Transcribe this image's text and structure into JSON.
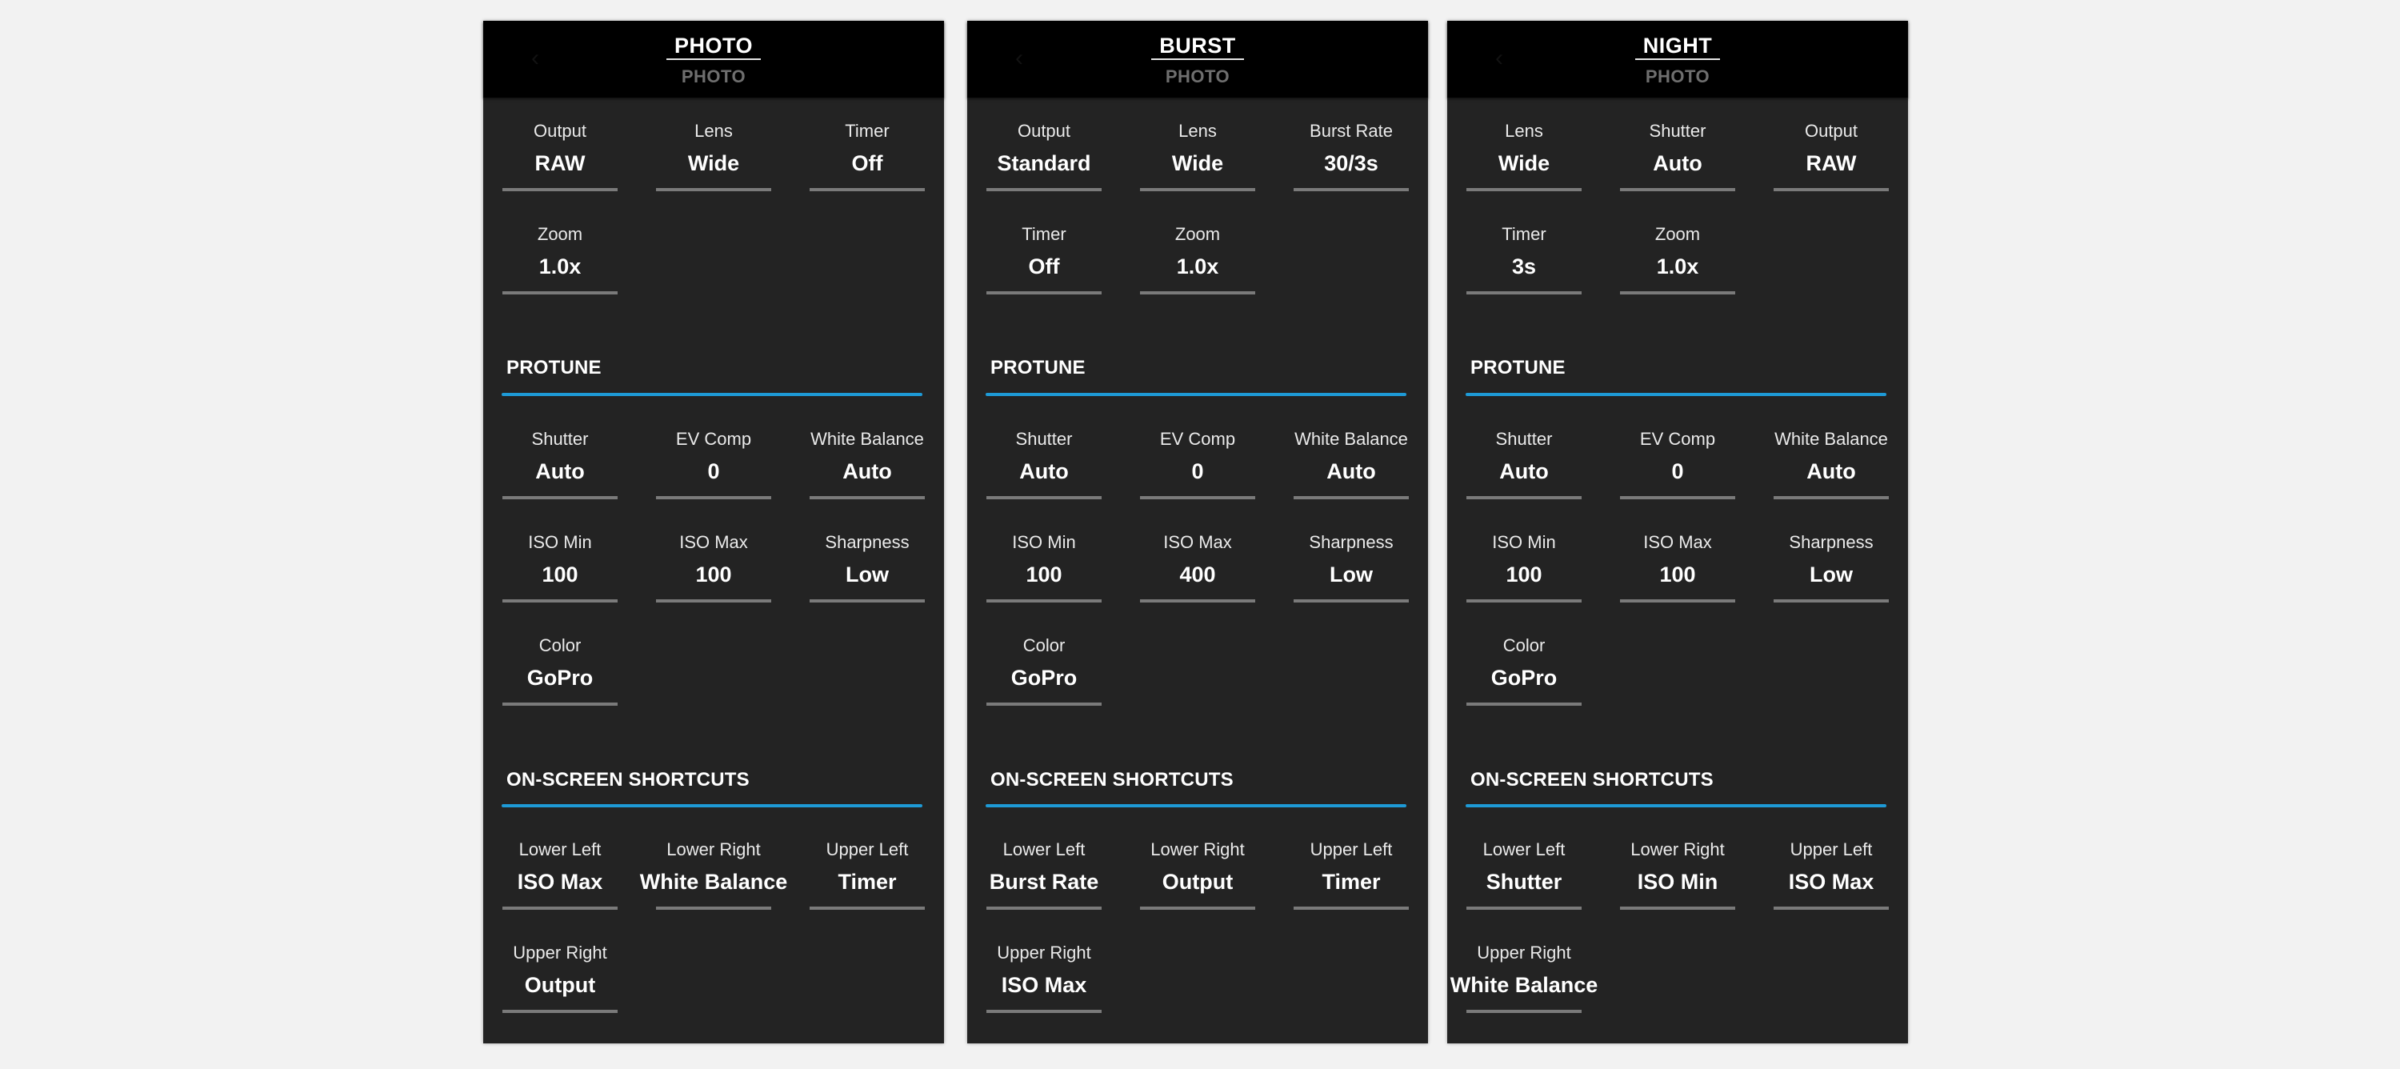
{
  "theme": {
    "accent": "#1e9ad6",
    "page_bg": "#f2f2f2",
    "panel_bg": "#232323",
    "header_bg": "#000000",
    "subtitle_color": "#6f6f6f",
    "underline_color": "#7a7a7a"
  },
  "panels": [
    {
      "title": "PHOTO",
      "subtitle": "PHOTO",
      "back_icon": "chevron-left-icon",
      "general": [
        {
          "label": "Output",
          "value": "RAW"
        },
        {
          "label": "Lens",
          "value": "Wide"
        },
        {
          "label": "Timer",
          "value": "Off"
        },
        {
          "label": "Zoom",
          "value": "1.0x"
        }
      ],
      "protune": {
        "title": "PROTUNE",
        "items": [
          {
            "label": "Shutter",
            "value": "Auto"
          },
          {
            "label": "EV Comp",
            "value": "0"
          },
          {
            "label": "White Balance",
            "value": "Auto"
          },
          {
            "label": "ISO Min",
            "value": "100"
          },
          {
            "label": "ISO Max",
            "value": "100"
          },
          {
            "label": "Sharpness",
            "value": "Low"
          },
          {
            "label": "Color",
            "value": "GoPro"
          }
        ]
      },
      "shortcuts": {
        "title": "ON-SCREEN SHORTCUTS",
        "items": [
          {
            "label": "Lower Left",
            "value": "ISO Max"
          },
          {
            "label": "Lower Right",
            "value": "White Balance"
          },
          {
            "label": "Upper Left",
            "value": "Timer"
          },
          {
            "label": "Upper Right",
            "value": "Output"
          }
        ]
      }
    },
    {
      "title": "BURST",
      "subtitle": "PHOTO",
      "back_icon": "chevron-left-icon",
      "general": [
        {
          "label": "Output",
          "value": "Standard"
        },
        {
          "label": "Lens",
          "value": "Wide"
        },
        {
          "label": "Burst Rate",
          "value": "30/3s"
        },
        {
          "label": "Timer",
          "value": "Off"
        },
        {
          "label": "Zoom",
          "value": "1.0x"
        }
      ],
      "protune": {
        "title": "PROTUNE",
        "items": [
          {
            "label": "Shutter",
            "value": "Auto"
          },
          {
            "label": "EV Comp",
            "value": "0"
          },
          {
            "label": "White Balance",
            "value": "Auto"
          },
          {
            "label": "ISO Min",
            "value": "100"
          },
          {
            "label": "ISO Max",
            "value": "400"
          },
          {
            "label": "Sharpness",
            "value": "Low"
          },
          {
            "label": "Color",
            "value": "GoPro"
          }
        ]
      },
      "shortcuts": {
        "title": "ON-SCREEN SHORTCUTS",
        "items": [
          {
            "label": "Lower Left",
            "value": "Burst Rate"
          },
          {
            "label": "Lower Right",
            "value": "Output"
          },
          {
            "label": "Upper Left",
            "value": "Timer"
          },
          {
            "label": "Upper Right",
            "value": "ISO Max"
          }
        ]
      }
    },
    {
      "title": "NIGHT",
      "subtitle": "PHOTO",
      "back_icon": "chevron-left-icon",
      "general": [
        {
          "label": "Lens",
          "value": "Wide"
        },
        {
          "label": "Shutter",
          "value": "Auto"
        },
        {
          "label": "Output",
          "value": "RAW"
        },
        {
          "label": "Timer",
          "value": "3s"
        },
        {
          "label": "Zoom",
          "value": "1.0x"
        }
      ],
      "protune": {
        "title": "PROTUNE",
        "items": [
          {
            "label": "Shutter",
            "value": "Auto"
          },
          {
            "label": "EV Comp",
            "value": "0"
          },
          {
            "label": "White Balance",
            "value": "Auto"
          },
          {
            "label": "ISO Min",
            "value": "100"
          },
          {
            "label": "ISO Max",
            "value": "100"
          },
          {
            "label": "Sharpness",
            "value": "Low"
          },
          {
            "label": "Color",
            "value": "GoPro"
          }
        ]
      },
      "shortcuts": {
        "title": "ON-SCREEN SHORTCUTS",
        "items": [
          {
            "label": "Lower Left",
            "value": "Shutter"
          },
          {
            "label": "Lower Right",
            "value": "ISO Min"
          },
          {
            "label": "Upper Left",
            "value": "ISO Max"
          },
          {
            "label": "Upper Right",
            "value": "White Balance"
          }
        ]
      }
    }
  ]
}
